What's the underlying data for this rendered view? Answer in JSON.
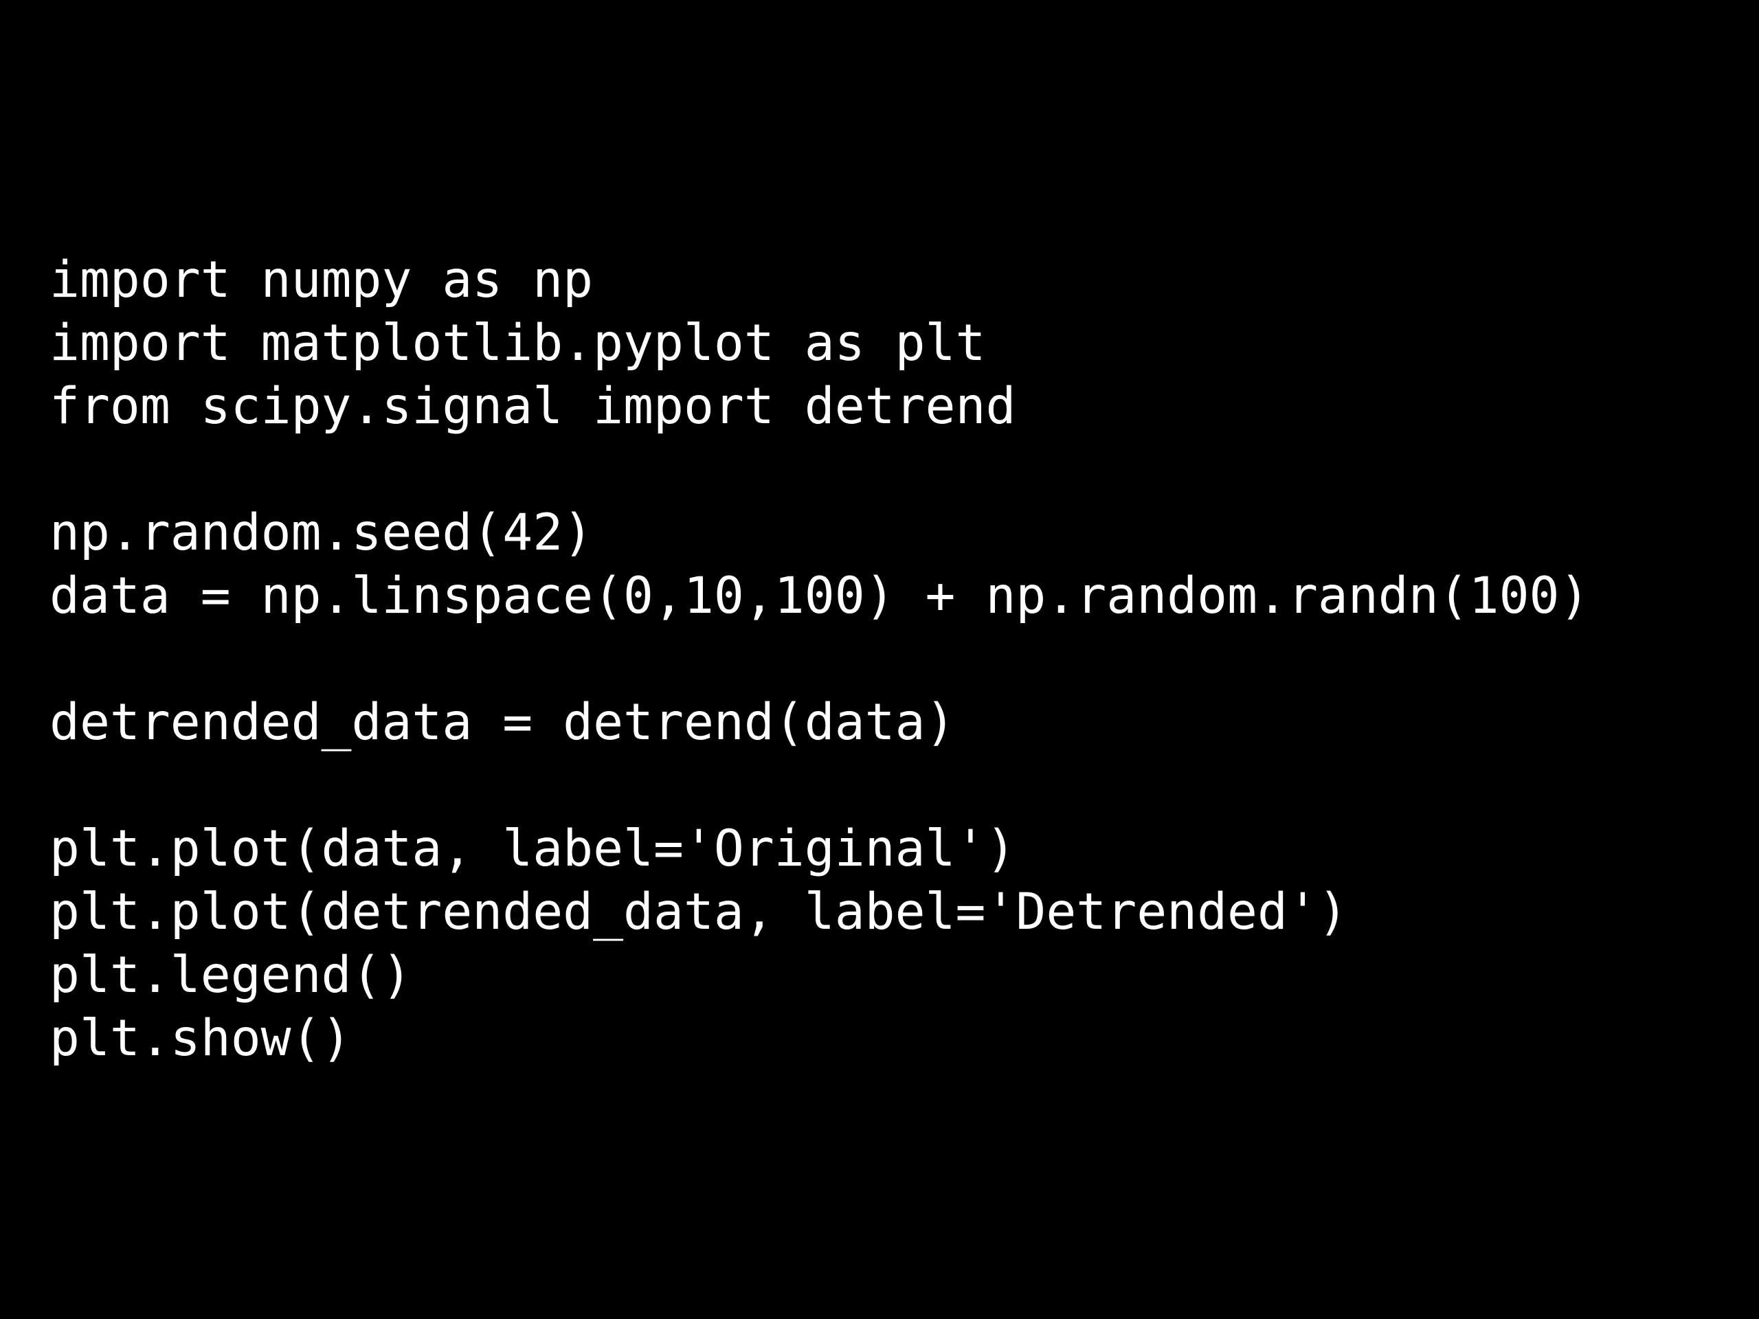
{
  "code": {
    "lines": [
      "import numpy as np",
      "import matplotlib.pyplot as plt",
      "from scipy.signal import detrend",
      "",
      "np.random.seed(42)",
      "data = np.linspace(0,10,100) + np.random.randn(100)",
      "",
      "detrended_data = detrend(data)",
      "",
      "plt.plot(data, label='Original')",
      "plt.plot(detrended_data, label='Detrended')",
      "plt.legend()",
      "plt.show()"
    ]
  }
}
